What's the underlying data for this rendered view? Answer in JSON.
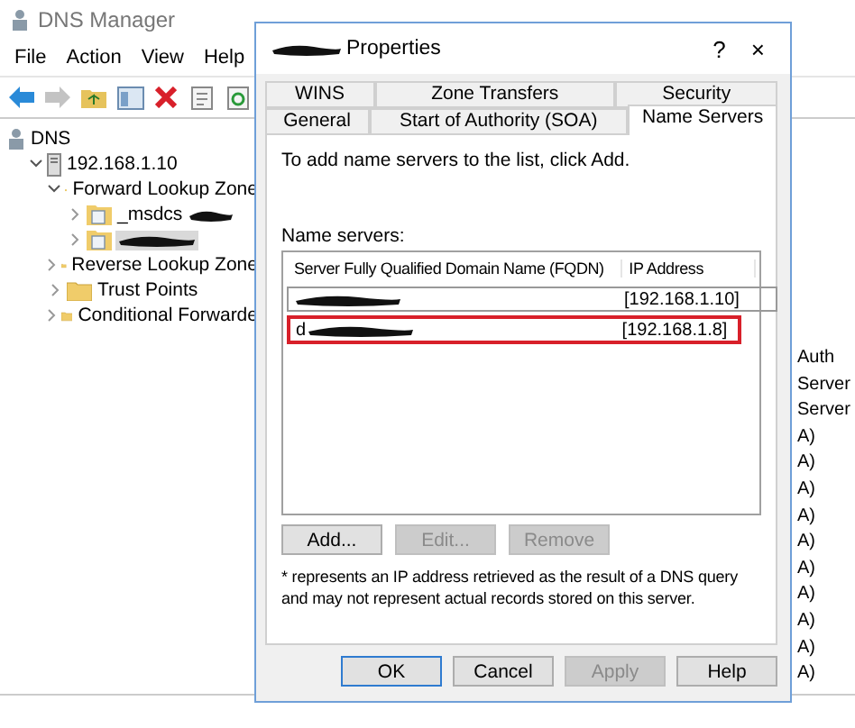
{
  "window": {
    "title": "DNS Manager"
  },
  "menu": [
    "File",
    "Action",
    "View",
    "Help"
  ],
  "toolbar": [
    {
      "kind": "back",
      "disabled": false
    },
    {
      "kind": "forward",
      "disabled": true
    },
    {
      "kind": "up",
      "disabled": false
    },
    {
      "kind": "tree",
      "disabled": false
    },
    {
      "kind": "delete",
      "disabled": false
    },
    {
      "kind": "properties",
      "disabled": false
    },
    {
      "kind": "refresh",
      "disabled": false
    }
  ],
  "tree": [
    {
      "label": "DNS",
      "kind": "root",
      "selected": false,
      "children": [
        {
          "label": "192.168.1.10",
          "kind": "server",
          "expanded": true,
          "selected": false,
          "children": [
            {
              "label": "Forward Lookup Zone",
              "kind": "folder",
              "expanded": true,
              "selected": false,
              "children": [
                {
                  "label": "_msdcs",
                  "kind": "zone",
                  "expanded": false,
                  "redacted": true,
                  "selected": false
                },
                {
                  "kind": "zone",
                  "expanded": false,
                  "redacted": true,
                  "selected": true
                }
              ]
            },
            {
              "label": "Reverse Lookup Zone",
              "kind": "folder",
              "expanded": false,
              "selected": false
            },
            {
              "label": "Trust Points",
              "kind": "folder",
              "expanded": false,
              "selected": false
            },
            {
              "label": "Conditional Forwarde",
              "kind": "folder",
              "expanded": false,
              "selected": false
            }
          ]
        }
      ]
    }
  ],
  "right_pane": {
    "lines": [
      "Auth",
      "Server",
      "Server",
      "A)",
      "A)",
      "A)",
      "A)",
      "A)",
      "A)",
      "A)",
      "A)",
      "A)",
      "A)"
    ]
  },
  "dialog": {
    "title": "Properties",
    "title_redacted": true,
    "help": "?",
    "close": "×",
    "tab_rows": [
      [
        {
          "label": "WINS",
          "selected": false
        },
        {
          "label": "Zone Transfers",
          "selected": false
        },
        {
          "label": "Security",
          "selected": false
        }
      ],
      [
        {
          "label": "General",
          "selected": false
        },
        {
          "label": "Start of Authority (SOA)",
          "selected": false
        },
        {
          "label": "Name Servers",
          "selected": true
        }
      ]
    ],
    "instruction": "To add name servers to the list, click Add.",
    "list_label": "Name servers:",
    "columns": [
      "Server Fully Qualified Domain Name (FQDN)",
      "IP Address"
    ],
    "rows": [
      {
        "fqdn_redacted": true,
        "ip": "[192.168.1.10]",
        "focused": true,
        "highlighted": false
      },
      {
        "fqdn": "d",
        "fqdn_redacted": true,
        "ip": "[192.168.1.8]",
        "focused": false,
        "highlighted": true
      }
    ],
    "list_buttons": [
      {
        "label": "Add...",
        "disabled": false
      },
      {
        "label": "Edit...",
        "disabled": true
      },
      {
        "label": "Remove",
        "disabled": true
      }
    ],
    "footnote": "* represents an IP address retrieved as the result of a DNS query and may not represent actual records stored on this server.",
    "buttons": [
      {
        "label": "OK",
        "disabled": false,
        "default": true
      },
      {
        "label": "Cancel",
        "disabled": false,
        "default": false
      },
      {
        "label": "Apply",
        "disabled": true,
        "default": false
      },
      {
        "label": "Help",
        "disabled": false,
        "default": false
      }
    ]
  }
}
